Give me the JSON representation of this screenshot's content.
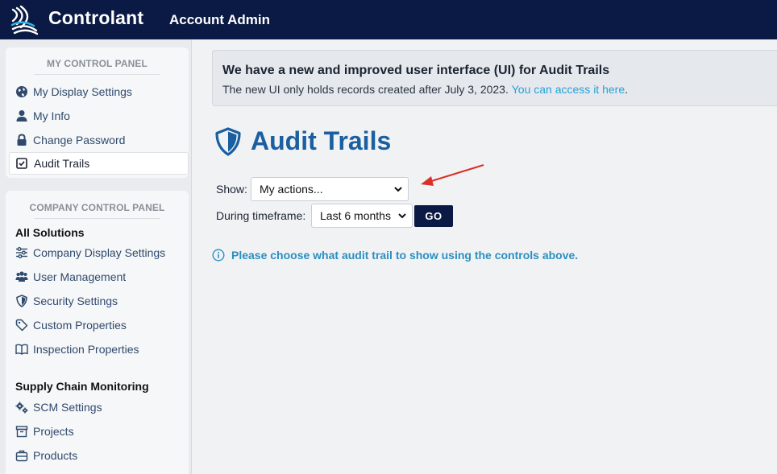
{
  "header": {
    "brand": "Controlant",
    "app_name": "Account Admin"
  },
  "sidebar": {
    "my_panel": {
      "title": "MY CONTROL PANEL",
      "items": [
        {
          "label": "My Display Settings",
          "icon": "globe-icon"
        },
        {
          "label": "My Info",
          "icon": "user-icon"
        },
        {
          "label": "Change Password",
          "icon": "lock-icon"
        },
        {
          "label": "Audit Trails",
          "icon": "checkbox-icon",
          "active": true
        }
      ]
    },
    "company_panel": {
      "title": "COMPANY CONTROL PANEL",
      "all_solutions": {
        "heading": "All Solutions",
        "items": [
          {
            "label": "Company Display Settings",
            "icon": "sliders-icon"
          },
          {
            "label": "User Management",
            "icon": "users-icon"
          },
          {
            "label": "Security Settings",
            "icon": "shield-icon"
          },
          {
            "label": "Custom Properties",
            "icon": "tag-icon"
          },
          {
            "label": "Inspection Properties",
            "icon": "book-icon"
          }
        ]
      },
      "scm": {
        "heading": "Supply Chain Monitoring",
        "items": [
          {
            "label": "SCM Settings",
            "icon": "gears-icon"
          },
          {
            "label": "Projects",
            "icon": "archive-icon"
          },
          {
            "label": "Products",
            "icon": "briefcase-icon"
          }
        ]
      }
    }
  },
  "banner": {
    "title": "We have a new and improved user interface (UI) for Audit Trails",
    "text_before": "The new UI only holds records created  after July 3, 2023.",
    "link": "You can access it here",
    "text_after": "."
  },
  "main": {
    "title": "Audit Trails",
    "show_label": "Show:",
    "show_value": "My actions...",
    "timeframe_label": "During timeframe:",
    "timeframe_value": "Last 6 months",
    "go_label": "GO",
    "info_text": "Please choose what audit trail to show using the controls above."
  },
  "colors": {
    "header_bg": "#0b1a44",
    "title_blue": "#1a5fa0",
    "link_blue": "#27a2d8",
    "annotation_arrow": "#d9312a"
  }
}
